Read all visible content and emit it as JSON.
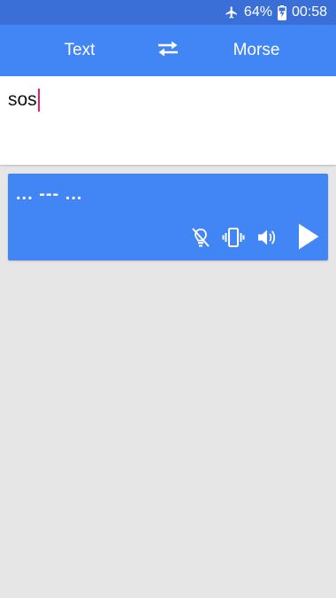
{
  "status_bar": {
    "battery": "64%",
    "time": "00:58",
    "icons": [
      "airplane-mode-icon",
      "battery-charging-icon"
    ]
  },
  "toolbar": {
    "source_label": "Text",
    "target_label": "Morse",
    "swap_icon": "swap-arrows-icon"
  },
  "input": {
    "value": "sos"
  },
  "output": {
    "morse": "... --- ...",
    "controls": [
      "flashlight-off-icon",
      "vibrate-icon",
      "volume-icon",
      "play-icon"
    ]
  },
  "colors": {
    "status_bar": "#3a6fd8",
    "primary": "#4285f4",
    "background": "#e6e6e6",
    "caret": "#e91e63"
  }
}
